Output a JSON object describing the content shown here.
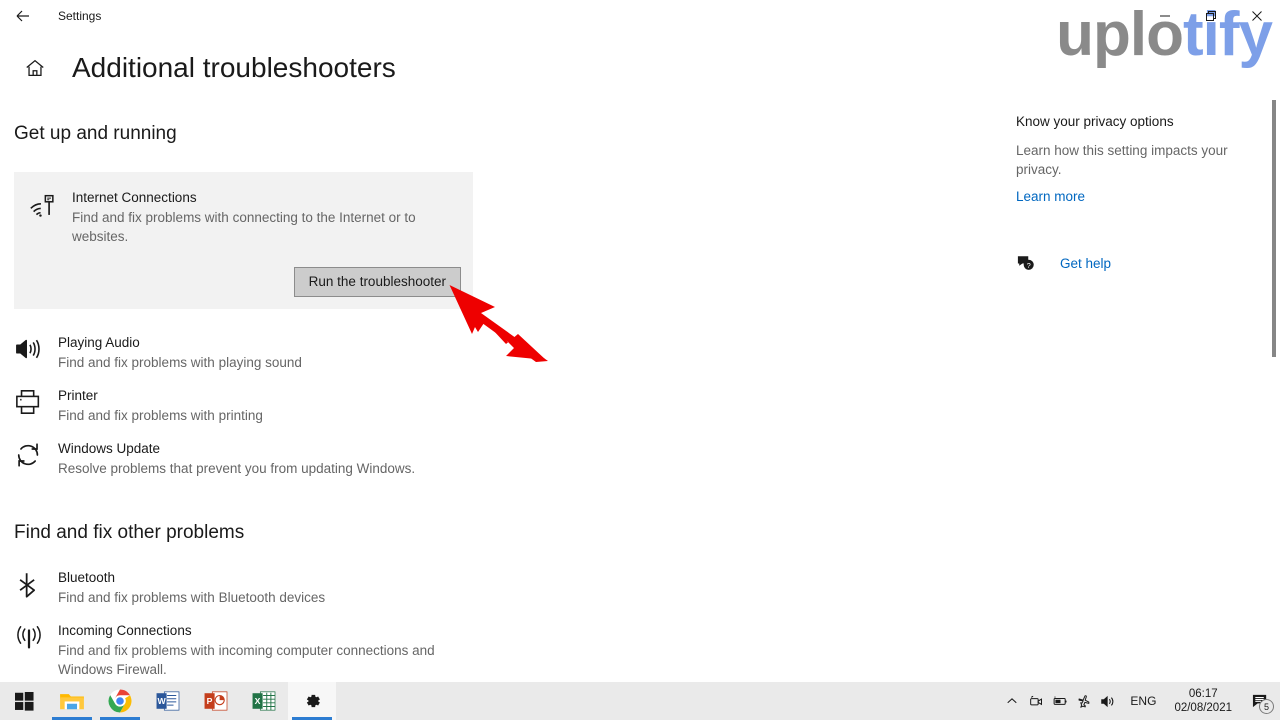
{
  "window": {
    "title": "Settings",
    "back_icon": "back-arrow-icon",
    "minimize_label": "Minimize",
    "maximize_label": "Restore",
    "close_label": "Close"
  },
  "watermark": {
    "part1": "uplo",
    "part2": "tify"
  },
  "header": {
    "home_icon": "home-icon",
    "title": "Additional troubleshooters"
  },
  "sections": [
    {
      "title": "Get up and running",
      "items": [
        {
          "icon": "internet-connections-icon",
          "name": "Internet Connections",
          "desc": "Find and fix problems with connecting to the Internet or to websites.",
          "highlighted": true,
          "button": "Run the troubleshooter"
        },
        {
          "icon": "playing-audio-icon",
          "name": "Playing Audio",
          "desc": "Find and fix problems with playing sound"
        },
        {
          "icon": "printer-icon",
          "name": "Printer",
          "desc": "Find and fix problems with printing"
        },
        {
          "icon": "windows-update-icon",
          "name": "Windows Update",
          "desc": "Resolve problems that prevent you from updating Windows."
        }
      ]
    },
    {
      "title": "Find and fix other problems",
      "items": [
        {
          "icon": "bluetooth-icon",
          "name": "Bluetooth",
          "desc": "Find and fix problems with Bluetooth devices"
        },
        {
          "icon": "incoming-connections-icon",
          "name": "Incoming Connections",
          "desc": "Find and fix problems with incoming computer connections and Windows Firewall."
        }
      ]
    }
  ],
  "right_panel": {
    "title": "Know your privacy options",
    "desc": "Learn how this setting impacts your privacy.",
    "learn_more": "Learn more",
    "get_help_icon": "help-bubble-icon",
    "get_help": "Get help"
  },
  "annotation": {
    "type": "red-arrow",
    "points_to": "Run the troubleshooter"
  },
  "taskbar": {
    "items": [
      {
        "icon": "windows-start-icon",
        "label": "Start"
      },
      {
        "icon": "file-explorer-icon",
        "label": "File Explorer"
      },
      {
        "icon": "google-chrome-icon",
        "label": "Google Chrome"
      },
      {
        "icon": "word-icon",
        "label": "Word"
      },
      {
        "icon": "powerpoint-icon",
        "label": "PowerPoint"
      },
      {
        "icon": "excel-icon",
        "label": "Excel"
      },
      {
        "icon": "settings-gear-icon",
        "label": "Settings"
      }
    ],
    "tray": {
      "chevron": "chevron-up-icon",
      "camera": "camera-icon",
      "battery": "battery-icon",
      "airplane": "airplane-mode-icon",
      "volume": "volume-icon",
      "language": "ENG",
      "time": "06:17",
      "date": "02/08/2021",
      "notification_icon": "notification-icon",
      "notification_count": "5"
    }
  },
  "colors": {
    "accent_link": "#0067c0",
    "card_bg": "#f2f2f2",
    "button_bg": "#cccccc",
    "annotation_red": "#ee0000",
    "taskbar_bg": "#eaeaea"
  }
}
